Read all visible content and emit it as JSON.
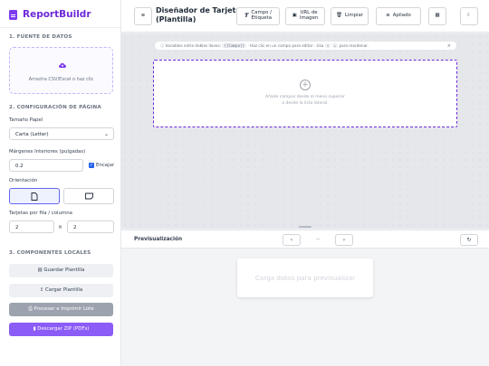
{
  "app": {
    "name": "ReportBuildr"
  },
  "sidebar": {
    "data_source": {
      "title": "1. FUENTE DE DATOS",
      "dropzone_text": "Arrastra CSV/Excel o haz clic"
    },
    "page_config": {
      "title": "2. CONFIGURACIÓN DE PÁGINA",
      "paper_label": "Tamaño Papel",
      "paper_value": "Carta (Letter)",
      "margins_label": "Márgenes Interiores (pulgadas)",
      "margins_value": "0.2",
      "fit_label": "Encajar",
      "fit_checked": true,
      "orientation_label": "Orientación",
      "orientation_selected": "portrait",
      "grid_label": "Tarjetas por fila / columna",
      "cols": "2",
      "times": "×",
      "rows": "2"
    },
    "local": {
      "title": "3. COMPONENTES LOCALES",
      "save": "Guardar Plantilla",
      "load": "Cargar Plantilla",
      "process": "Procesar e Imprimir Lote",
      "download": "Descargar ZIP (PDFs)"
    }
  },
  "toolbar": {
    "menu_icon": "≡",
    "title_line1": "Diseñador de Tarjeta",
    "title_line2": "(Plantilla)",
    "field_line1": "Campo /",
    "field_line2": "Etiqueta",
    "image_line1": "URL de",
    "image_line2": "Imagen",
    "clear": "Limpiar",
    "align": "Apilado"
  },
  "canvas": {
    "hint_prefix": "Variables entre dobles llaves:",
    "hint_code": "{{Campo}}",
    "hint_mid": "· Haz clic en un campo para editar · Usa",
    "hint_up": "↑",
    "hint_down": "↓",
    "hint_suffix": "para reordenar.",
    "hint_close": "×",
    "card_line1": "Añade campos desde el menú superior",
    "card_line2": "o desde la lista lateral."
  },
  "preview": {
    "title": "Previsualización",
    "prev": "‹",
    "page": "--",
    "next": "›",
    "empty": "Carga datos para previsualizar"
  },
  "colors": {
    "accent": "#7c3aed",
    "process_button": "#9ca3af",
    "download_button": "#8b5cf6"
  }
}
